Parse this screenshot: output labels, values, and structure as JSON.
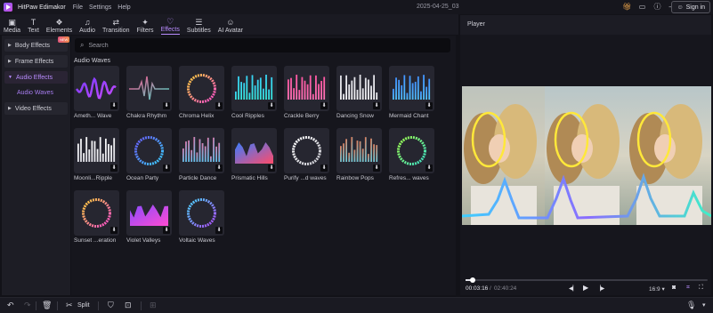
{
  "titlebar": {
    "app_name": "HitPaw Edimakor",
    "menus": [
      "File",
      "Settings",
      "Help"
    ],
    "project_title": "2025-04-25_03",
    "signin_label": "Sign in"
  },
  "toolbar": {
    "items": [
      {
        "label": "Media",
        "icon": "media-icon",
        "glyph": "▣"
      },
      {
        "label": "Text",
        "icon": "text-icon",
        "glyph": "T"
      },
      {
        "label": "Elements",
        "icon": "elements-icon",
        "glyph": "❖"
      },
      {
        "label": "Audio",
        "icon": "audio-icon",
        "glyph": "♫"
      },
      {
        "label": "Transition",
        "icon": "transition-icon",
        "glyph": "⇄"
      },
      {
        "label": "Filters",
        "icon": "filters-icon",
        "glyph": "✦"
      },
      {
        "label": "Effects",
        "icon": "effects-icon",
        "glyph": "♡"
      },
      {
        "label": "Subtitles",
        "icon": "subtitles-icon",
        "glyph": "☰"
      },
      {
        "label": "AI Avatar",
        "icon": "ai-avatar-icon",
        "glyph": "☺"
      }
    ],
    "active": "Effects"
  },
  "sidebar": {
    "items": [
      {
        "label": "Body Effects",
        "badge": "NEW"
      },
      {
        "label": "Frame Effects"
      },
      {
        "label": "Audio Effects"
      },
      {
        "label": "Video Effects"
      }
    ],
    "active": "Audio Effects",
    "subitem": "Audio Waves"
  },
  "search": {
    "placeholder": "Search"
  },
  "section_title": "Audio Waves",
  "effects": [
    "Ameth... Wave",
    "Chakra Rhythm",
    "Chroma Helix",
    "Cool Ripples",
    "Crackle Berry",
    "Dancing Snow",
    "Mermaid Chant",
    "Moonli...Ripple",
    "Ocean Party",
    "Particle Dance",
    "Prismatic Hills",
    "Purify ...d waves",
    "Rainbow Pops",
    "Refres... waves",
    "Sunset ...eration",
    "Violet Valleys",
    "Voltaic Waves"
  ],
  "player": {
    "title": "Player",
    "current_time": "00:03:16",
    "separator": "/",
    "total_time": "02:40:24",
    "aspect_ratio": "16:9 ▾",
    "progress": 0.02
  },
  "bottombar": {
    "split_label": "Split"
  },
  "colors": {
    "accent": "#b98cff",
    "background": "#121218",
    "panel": "#16161d"
  }
}
